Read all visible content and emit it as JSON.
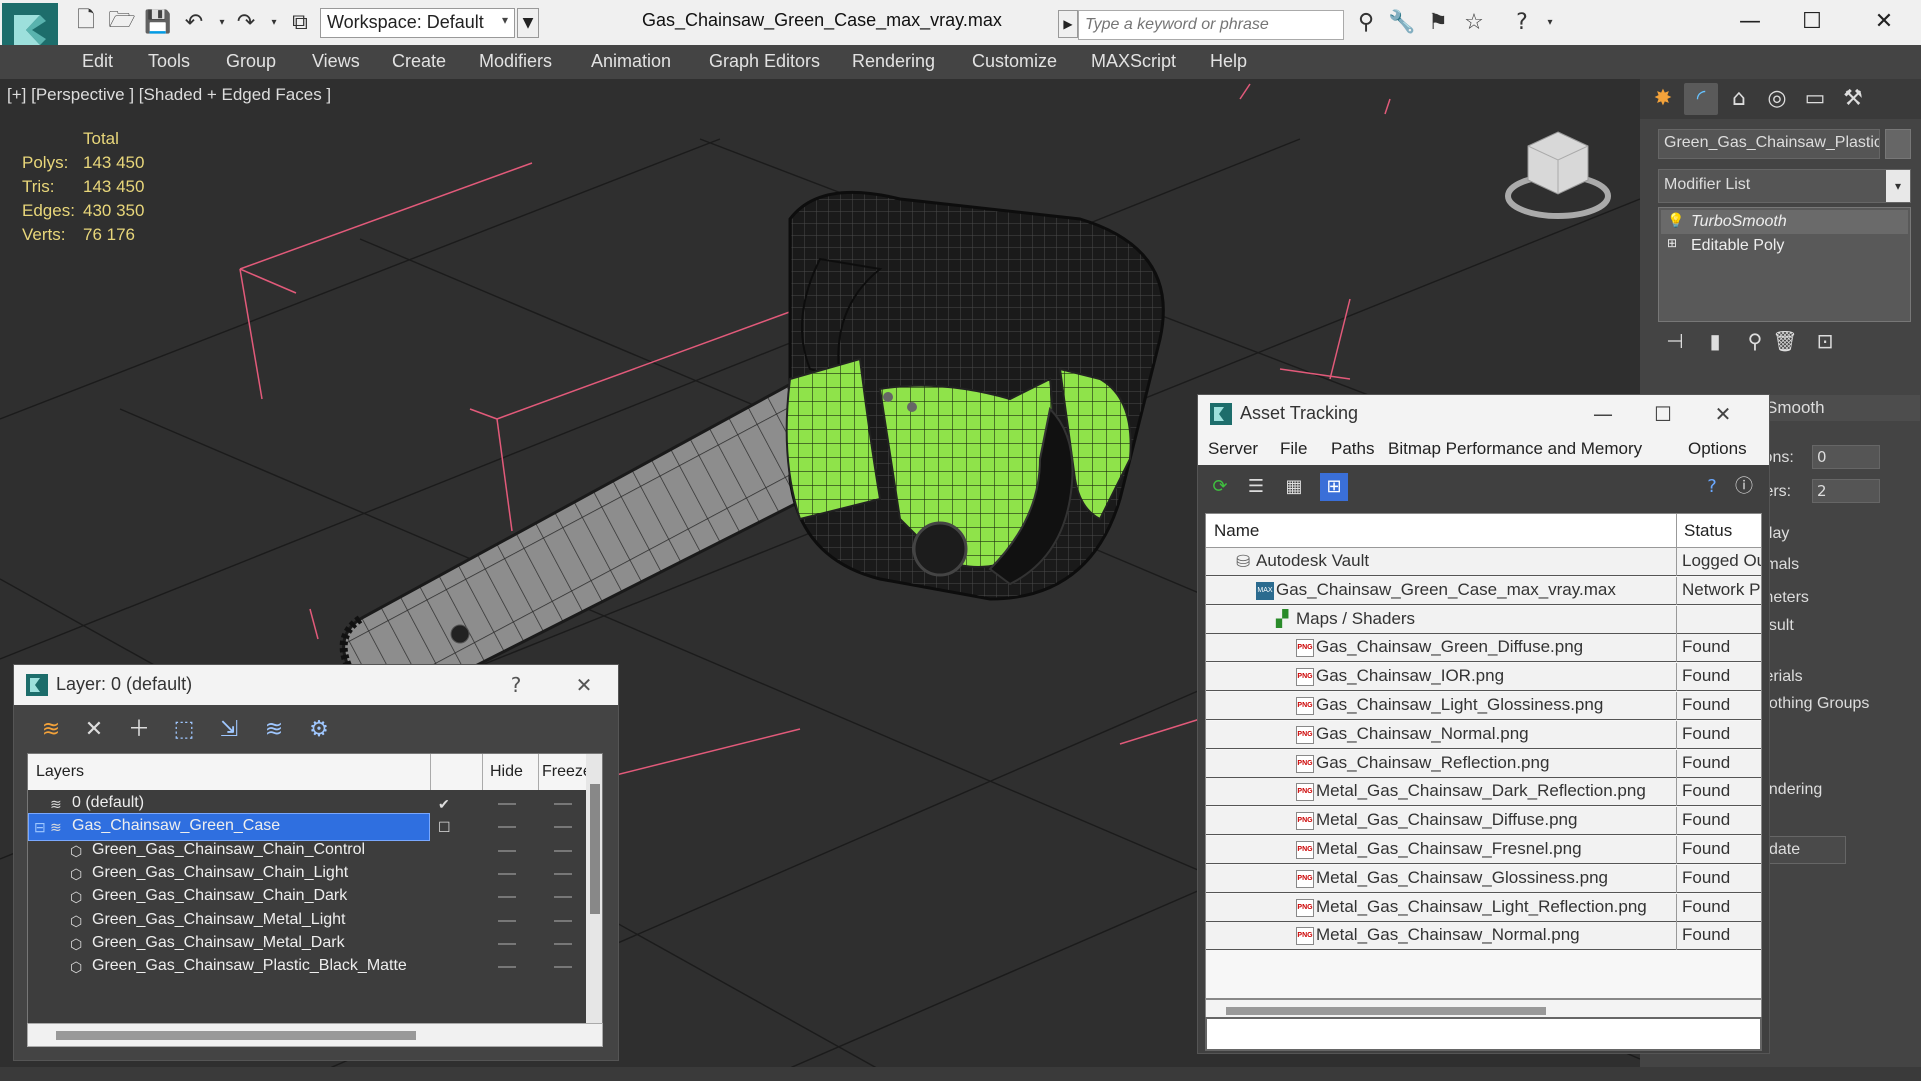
{
  "titlebar": {
    "workspace": "Workspace: Default",
    "doc_title": "Gas_Chainsaw_Green_Case_max_vray.max",
    "search_placeholder": "Type a keyword or phrase"
  },
  "menu": [
    "Edit",
    "Tools",
    "Group",
    "Views",
    "Create",
    "Modifiers",
    "Animation",
    "Graph Editors",
    "Rendering",
    "Customize",
    "MAXScript",
    "Help"
  ],
  "viewport": {
    "label": "[+] [Perspective ] [Shaded + Edged Faces ]",
    "stats": {
      "header": "Total",
      "rows": [
        {
          "label": "Polys:",
          "value": "143 450"
        },
        {
          "label": "Tris:",
          "value": "143 450"
        },
        {
          "label": "Edges:",
          "value": "430 350"
        },
        {
          "label": "Verts:",
          "value": "76 176"
        }
      ]
    },
    "axis_x": "x",
    "accent_green": "#8fe34a"
  },
  "command_panel": {
    "object_name": "Green_Gas_Chainsaw_Plastic_G",
    "modifier_list": "Modifier List",
    "stack": [
      "TurboSmooth",
      "Editable Poly"
    ],
    "rollout_title": "Smooth",
    "labels": [
      "ions:",
      "ters:",
      "play",
      "rmals",
      "meters",
      "esult",
      "terials",
      "oothing Groups",
      "s",
      "endering",
      "date"
    ],
    "iterations_value": "0",
    "render_iters_value": "2"
  },
  "asset_tracking": {
    "title": "Asset Tracking",
    "menu": [
      "Server",
      "File",
      "Paths",
      "Bitmap Performance and Memory",
      "Options"
    ],
    "columns": {
      "name": "Name",
      "status": "Status"
    },
    "rows": [
      {
        "name": "Autodesk Vault",
        "status": "Logged Out",
        "level": 1,
        "icon": "vault"
      },
      {
        "name": "Gas_Chainsaw_Green_Case_max_vray.max",
        "status": "Network Path",
        "level": 2,
        "icon": "max"
      },
      {
        "name": "Maps / Shaders",
        "status": "",
        "level": 3,
        "icon": "map"
      },
      {
        "name": "Gas_Chainsaw_Green_Diffuse.png",
        "status": "Found",
        "level": 4,
        "icon": "png"
      },
      {
        "name": "Gas_Chainsaw_IOR.png",
        "status": "Found",
        "level": 4,
        "icon": "png"
      },
      {
        "name": "Gas_Chainsaw_Light_Glossiness.png",
        "status": "Found",
        "level": 4,
        "icon": "png"
      },
      {
        "name": "Gas_Chainsaw_Normal.png",
        "status": "Found",
        "level": 4,
        "icon": "png"
      },
      {
        "name": "Gas_Chainsaw_Reflection.png",
        "status": "Found",
        "level": 4,
        "icon": "png"
      },
      {
        "name": "Metal_Gas_Chainsaw_Dark_Reflection.png",
        "status": "Found",
        "level": 4,
        "icon": "png"
      },
      {
        "name": "Metal_Gas_Chainsaw_Diffuse.png",
        "status": "Found",
        "level": 4,
        "icon": "png"
      },
      {
        "name": "Metal_Gas_Chainsaw_Fresnel.png",
        "status": "Found",
        "level": 4,
        "icon": "png"
      },
      {
        "name": "Metal_Gas_Chainsaw_Glossiness.png",
        "status": "Found",
        "level": 4,
        "icon": "png"
      },
      {
        "name": "Metal_Gas_Chainsaw_Light_Reflection.png",
        "status": "Found",
        "level": 4,
        "icon": "png"
      },
      {
        "name": "Metal_Gas_Chainsaw_Normal.png",
        "status": "Found",
        "level": 4,
        "icon": "png"
      }
    ]
  },
  "layers": {
    "title": "Layer: 0 (default)",
    "help": "?",
    "columns": {
      "layers": "Layers",
      "hide": "Hide",
      "freeze": "Freeze"
    },
    "rows": [
      {
        "name": "0 (default)",
        "level": 1,
        "kind": "layer",
        "selected": false
      },
      {
        "name": "Gas_Chainsaw_Green_Case",
        "level": 1,
        "kind": "layer",
        "selected": true
      },
      {
        "name": "Green_Gas_Chainsaw_Chain_Control",
        "level": 2,
        "kind": "object",
        "selected": false
      },
      {
        "name": "Green_Gas_Chainsaw_Chain_Light",
        "level": 2,
        "kind": "object",
        "selected": false
      },
      {
        "name": "Green_Gas_Chainsaw_Chain_Dark",
        "level": 2,
        "kind": "object",
        "selected": false
      },
      {
        "name": "Green_Gas_Chainsaw_Metal_Light",
        "level": 2,
        "kind": "object",
        "selected": false
      },
      {
        "name": "Green_Gas_Chainsaw_Metal_Dark",
        "level": 2,
        "kind": "object",
        "selected": false
      },
      {
        "name": "Green_Gas_Chainsaw_Plastic_Black_Matte",
        "level": 2,
        "kind": "object",
        "selected": false
      }
    ]
  }
}
